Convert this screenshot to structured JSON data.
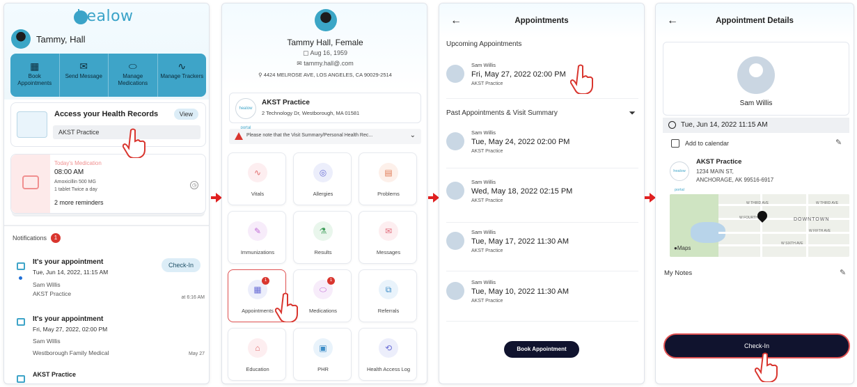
{
  "screen1": {
    "logo": "healow",
    "user_name": "Tammy, Hall",
    "quick_actions": [
      {
        "label": "Book Appointments",
        "icon": "calendar-search-icon"
      },
      {
        "label": "Send Message",
        "icon": "envelope-icon"
      },
      {
        "label": "Manage Medications",
        "icon": "pill-icon"
      },
      {
        "label": "Manage Trackers",
        "icon": "pulse-icon"
      }
    ],
    "health_records": {
      "title": "Access your Health Records",
      "view_label": "View",
      "practice": "AKST Practice"
    },
    "medication": {
      "today_label": "Today's Medication",
      "time": "08:00 AM",
      "name": "Amoxicillin 500 MG",
      "dose": "1 tablet Twice a day",
      "more": "2 more reminders"
    },
    "notifications": {
      "label": "Notifications",
      "count": "1",
      "items": [
        {
          "title": "It's your appointment",
          "date": "Tue, Jun 14, 2022, 11:15 AM",
          "doctor": "Sam  Willis",
          "practice": "AKST Practice",
          "time": "at 6:16 AM",
          "action": "Check-In"
        },
        {
          "title": "It's your appointment",
          "date": "Fri, May 27, 2022, 02:00 PM",
          "doctor": "Sam  Willis",
          "practice": "Westborough Family Medical",
          "time": "May 27"
        },
        {
          "title": "AKST Practice"
        }
      ]
    }
  },
  "screen2": {
    "name": "Tammy Hall, Female",
    "dob": "Aug 16, 1959",
    "email": "tammy.hall@.com",
    "address": "4424 MELROSE AVE, LOS ANGELES, CA 90029-2514",
    "practice": {
      "name": "AKST Practice",
      "address": "2 Technology Dr, Westborough, MA 01581",
      "logo_text": "healow portal"
    },
    "warning": "Please note that the Visit Summary/Personal Health Rec...",
    "tiles": [
      {
        "label": "Vitals",
        "icon": "pulse-icon"
      },
      {
        "label": "Allergies",
        "icon": "allergy-icon"
      },
      {
        "label": "Problems",
        "icon": "problems-icon"
      },
      {
        "label": "Immunizations",
        "icon": "syringe-icon"
      },
      {
        "label": "Results",
        "icon": "flask-icon"
      },
      {
        "label": "Messages",
        "icon": "envelope-icon"
      },
      {
        "label": "Appointments",
        "icon": "calendar-icon",
        "badge": "1"
      },
      {
        "label": "Medications",
        "icon": "pill-icon",
        "badge": "1"
      },
      {
        "label": "Referrals",
        "icon": "referrals-icon"
      },
      {
        "label": "Education",
        "icon": "graduation-cap-icon"
      },
      {
        "label": "PHR",
        "icon": "phr-icon"
      },
      {
        "label": "Health Access Log",
        "icon": "access-log-icon"
      }
    ]
  },
  "screen3": {
    "title": "Appointments",
    "upcoming_label": "Upcoming Appointments",
    "upcoming": [
      {
        "doctor": "Sam Willis",
        "datetime": "Fri, May 27, 2022 02:00 PM",
        "practice": "AKST Practice"
      }
    ],
    "past_label": "Past Appointments & Visit Summary",
    "past": [
      {
        "doctor": "Sam Willis",
        "datetime": "Tue, May 24, 2022 02:00 PM",
        "practice": "AKST Practice"
      },
      {
        "doctor": "Sam Willis",
        "datetime": "Wed, May 18, 2022 02:15 PM",
        "practice": "AKST Practice"
      },
      {
        "doctor": "Sam Willis",
        "datetime": "Tue, May 17, 2022 11:30 AM",
        "practice": "AKST Practice"
      },
      {
        "doctor": "Sam Willis",
        "datetime": "Tue, May 10, 2022 11:30 AM",
        "practice": "AKST Practice"
      }
    ],
    "book_label": "Book Appointment"
  },
  "screen4": {
    "title": "Appointment Details",
    "doctor": "Sam Willis",
    "datetime": "Tue, Jun 14, 2022 11:15 AM",
    "add_calendar": "Add to calendar",
    "practice": {
      "name": "AKST Practice",
      "address1": "1234 MAIN ST,",
      "address2": "ANCHORAGE, AK 99516-6917",
      "logo_text": "healow portal"
    },
    "map": {
      "downtown": "DOWNTOWN",
      "brand": "Maps",
      "streets": [
        "W THIRD AVE",
        "W THIRD AVE",
        "W FOURTH AVE",
        "W FIFTH AVE",
        "W SIXTH AVE"
      ]
    },
    "notes_label": "My Notes",
    "checkin_label": "Check-In"
  },
  "colors": {
    "brand_blue": "#3ea4c8",
    "navy": "#10132e",
    "alert_red": "#d9362f",
    "highlight_red": "#e05252"
  }
}
